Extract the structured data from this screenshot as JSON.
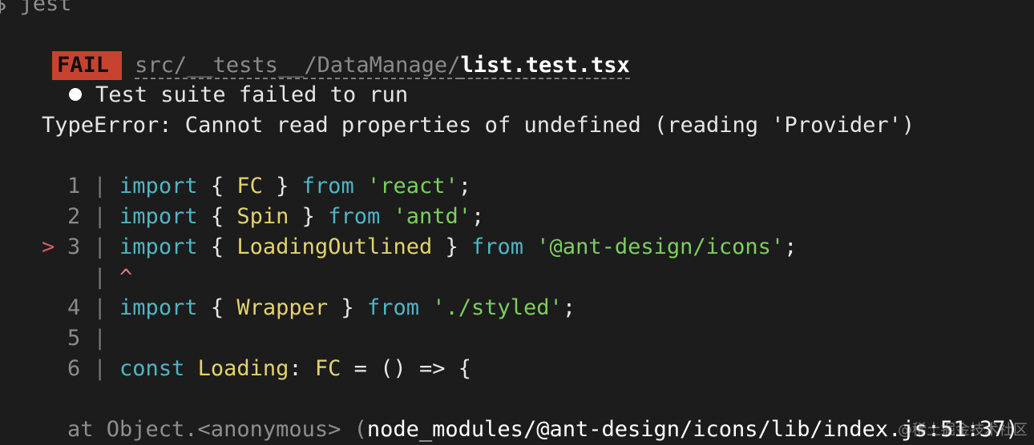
{
  "terminal": {
    "command": "$ jest",
    "status_badge": "FAIL",
    "test_path_dir": "src/__tests__/DataManage/",
    "test_path_file": "list.test.tsx",
    "suite_message": "Test suite failed to run",
    "error_message": "TypeError: Cannot read properties of undefined (reading 'Provider')",
    "code_frame": {
      "lines": [
        {
          "num": "1",
          "marker": "",
          "kw1": "import",
          "p1": " { ",
          "id": "FC",
          "p2": " } ",
          "kw2": "from",
          "p3": " ",
          "str": "'react'",
          "end": ";"
        },
        {
          "num": "2",
          "marker": "",
          "kw1": "import",
          "p1": " { ",
          "id": "Spin",
          "p2": " } ",
          "kw2": "from",
          "p3": " ",
          "str": "'antd'",
          "end": ";"
        },
        {
          "num": "3",
          "marker": ">",
          "kw1": "import",
          "p1": " { ",
          "id": "LoadingOutlined",
          "p2": " } ",
          "kw2": "from",
          "p3": " ",
          "str": "'@ant-design/icons'",
          "end": ";"
        },
        {
          "num": "4",
          "marker": "",
          "kw1": "import",
          "p1": " { ",
          "id": "Wrapper",
          "p2": " } ",
          "kw2": "from",
          "p3": " ",
          "str": "'./styled'",
          "end": ";"
        }
      ],
      "caret": "^",
      "line5_num": "5",
      "line6": {
        "num": "6",
        "kw": "const",
        "name": "Loading",
        "colon": ": ",
        "type": "FC",
        "rest": " = () => {"
      }
    },
    "stack_prefix": "at Object.<anonymous> (",
    "stack_path": "node_modules/@ant-design/icons/lib/index.js:51:37)"
  },
  "watermark": "@稀土掘金技术社区"
}
